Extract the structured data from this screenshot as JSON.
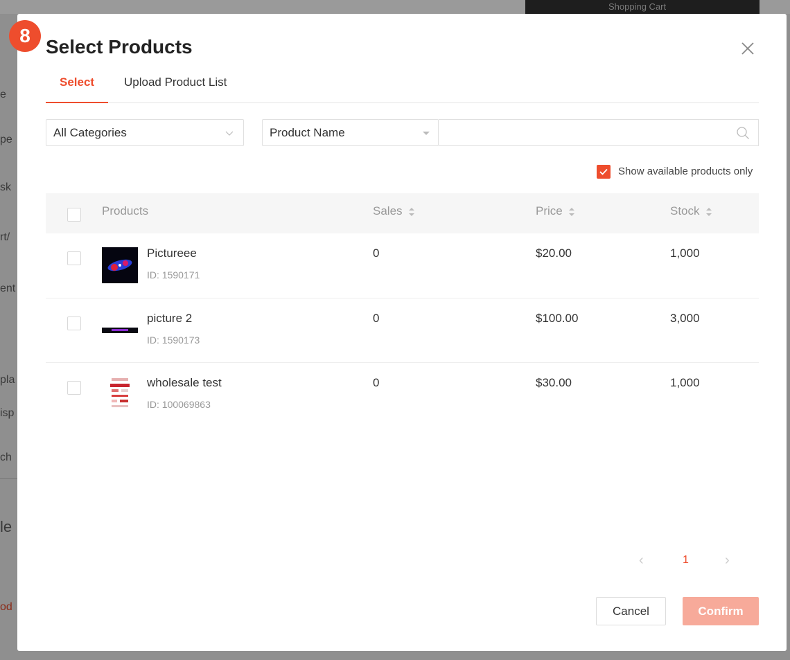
{
  "step_badge": "8",
  "background": {
    "cart_label": "Shopping Cart",
    "left_fragments": [
      "e",
      "pe",
      "sk",
      "rt/",
      "ent",
      "pla",
      "isp",
      "ch",
      "le",
      "od"
    ]
  },
  "modal": {
    "title": "Select Products",
    "tabs": [
      {
        "label": "Select",
        "active": true
      },
      {
        "label": "Upload Product List",
        "active": false
      }
    ],
    "filters": {
      "category": "All Categories",
      "search_field": "Product Name",
      "search_value": ""
    },
    "available_only": {
      "label": "Show available products only",
      "checked": true
    },
    "table": {
      "headers": {
        "products": "Products",
        "sales": "Sales",
        "price": "Price",
        "stock": "Stock"
      },
      "rows": [
        {
          "name": "Pictureee",
          "id": "ID: 1590171",
          "sales": "0",
          "price": "$20.00",
          "stock": "1,000"
        },
        {
          "name": "picture 2",
          "id": "ID: 1590173",
          "sales": "0",
          "price": "$100.00",
          "stock": "3,000"
        },
        {
          "name": "wholesale test",
          "id": "ID: 100069863",
          "sales": "0",
          "price": "$30.00",
          "stock": "1,000"
        }
      ]
    },
    "pagination": {
      "prev": "‹",
      "current": "1",
      "next": "›"
    },
    "buttons": {
      "cancel": "Cancel",
      "confirm": "Confirm"
    }
  },
  "colors": {
    "accent": "#ee4d2d",
    "confirm_disabled": "#f7aa9a"
  }
}
